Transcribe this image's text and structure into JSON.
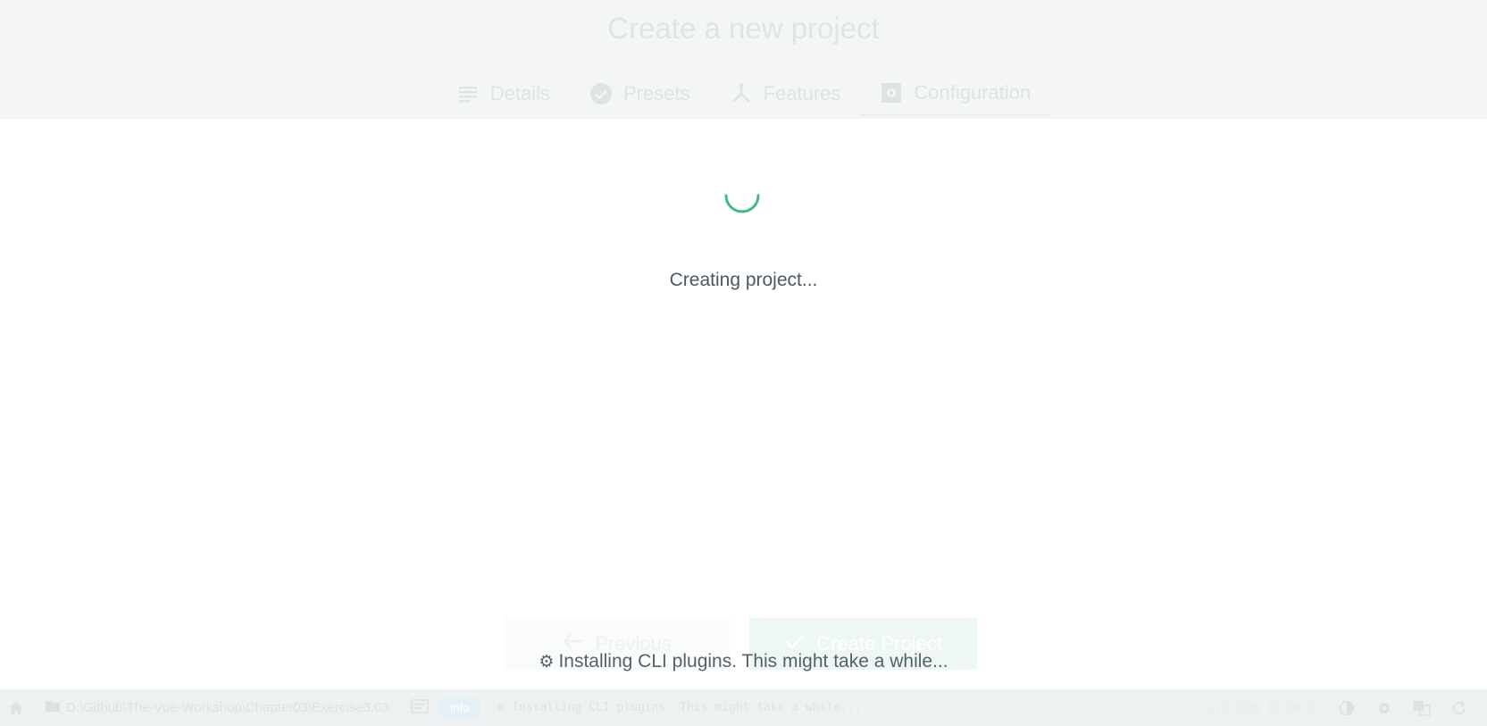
{
  "header": {
    "title": "Create a new project",
    "tabs": [
      {
        "label": "Details",
        "icon": "details-icon"
      },
      {
        "label": "Presets",
        "icon": "check-circle-icon"
      },
      {
        "label": "Features",
        "icon": "fork-icon"
      },
      {
        "label": "Configuration",
        "icon": "settings-box-icon",
        "selected": true
      }
    ]
  },
  "loading": {
    "spinner_color": "#42b983",
    "message": "Creating project..."
  },
  "footer": {
    "previous_label": "Previous",
    "create_label": "Create Project",
    "status_message": "Installing CLI plugins. This might take a while...",
    "status_icon": "gear-icon"
  },
  "statusbar": {
    "path": "D:\\Github\\The-Vue-Workshop\\Chapter03\\Exercise3.03",
    "badge": "Info",
    "log_message": "⚙ Installing CLI plugins. This might take a while...",
    "time": "2/3/2020 10:38:37"
  },
  "colors": {
    "accent": "#42b983",
    "text": "#4a5861"
  }
}
